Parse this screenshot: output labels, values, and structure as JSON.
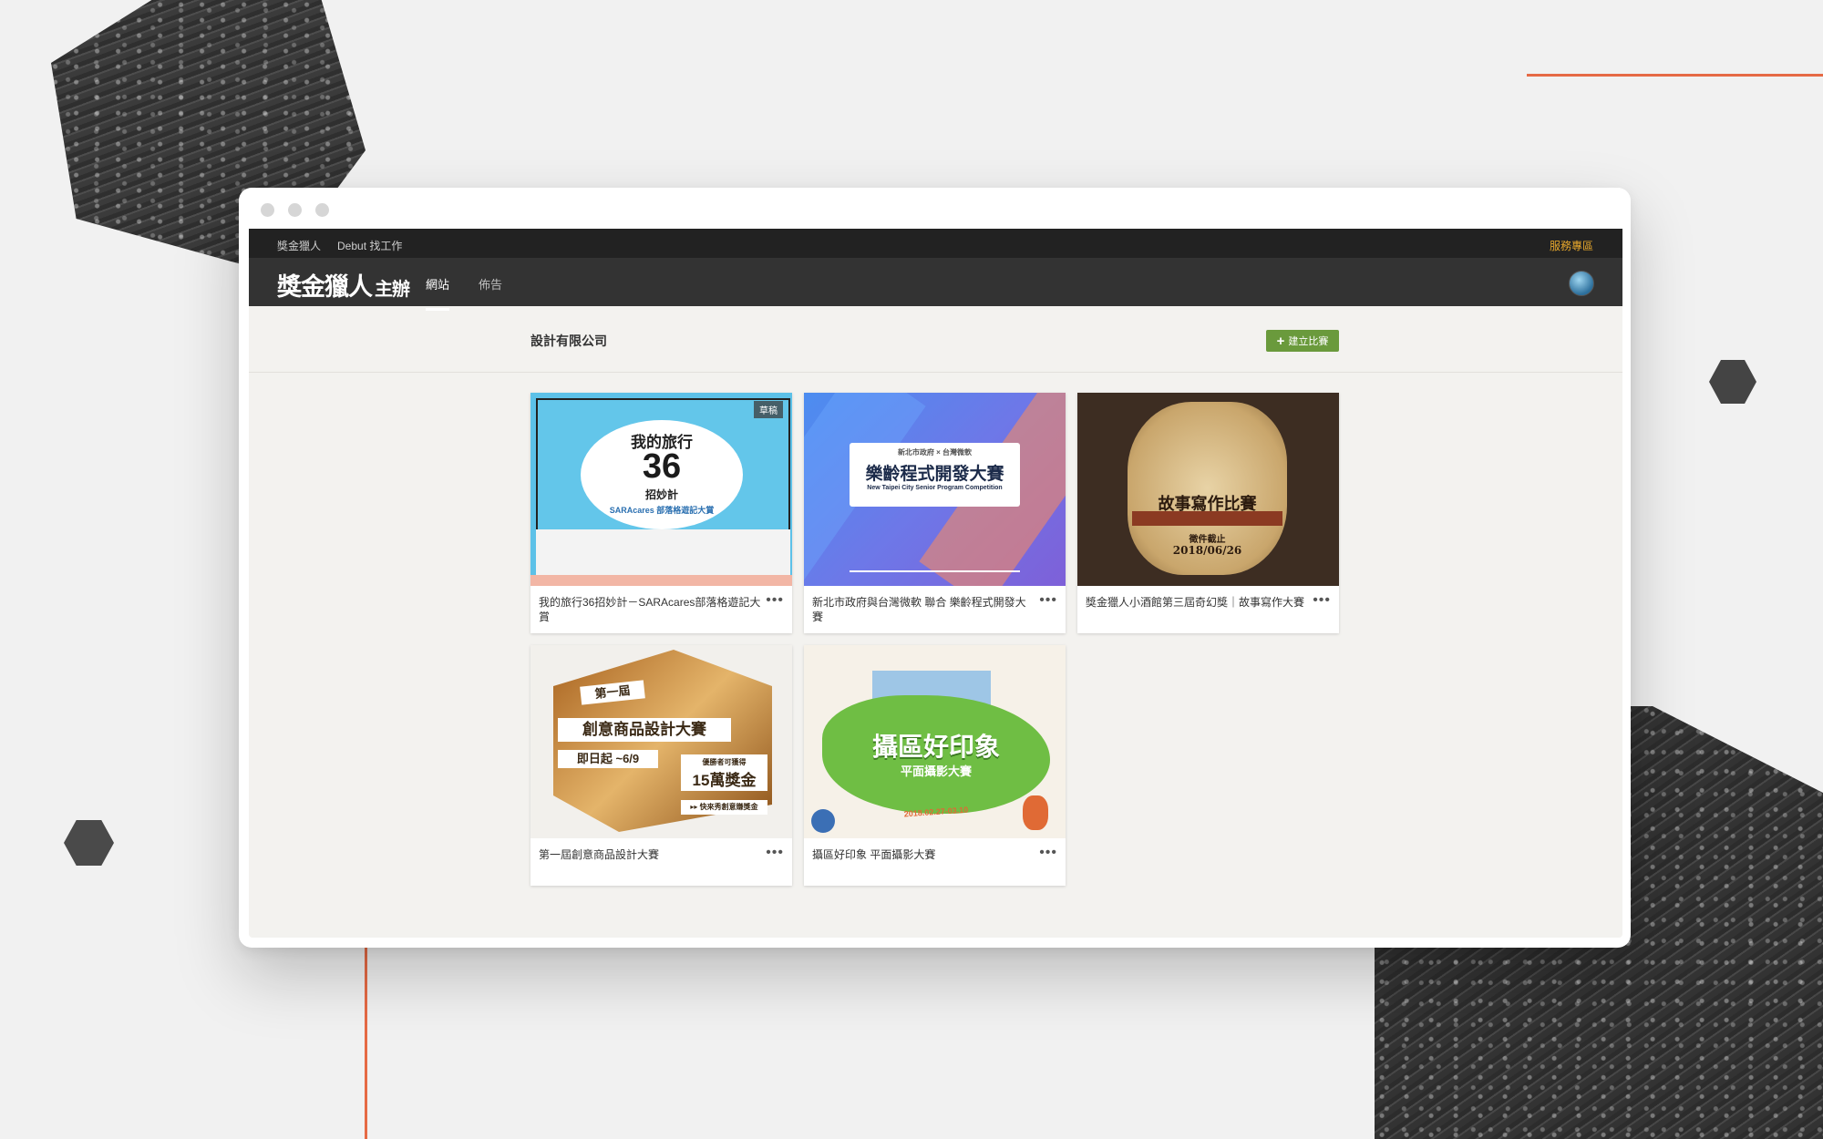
{
  "topbar": {
    "links": [
      "獎金獵人",
      "Debut 找工作"
    ],
    "service": "服務專區"
  },
  "navbar": {
    "logo": "獎金獵人",
    "logo_mark": "主辦",
    "tabs": [
      {
        "label": "網站",
        "active": true
      },
      {
        "label": "佈告",
        "active": false
      }
    ]
  },
  "page": {
    "company": "設計有限公司",
    "create_label": "建立比賽"
  },
  "cards": [
    {
      "title": "我的旅行36招妙計－SARAcares部落格遊記大賞",
      "badge": "草稿",
      "poster": {
        "line1": "我的旅行",
        "big": "36",
        "line2": "招妙計",
        "line3": "SARAcares 部落格遊記大賞"
      }
    },
    {
      "title": "新北市政府與台灣微軟 聯合 樂齡程式開發大賽",
      "poster": {
        "small": "新北市政府 × 台灣微軟",
        "main": "樂齡程式開發大賽",
        "sub": "New Taipei City Senior Program Competition"
      }
    },
    {
      "title": "獎金獵人小酒館第三屆奇幻獎｜故事寫作大賽",
      "poster": {
        "main": "故事寫作比賽",
        "deadline_label": "徵件截止",
        "deadline": "2018/06/26"
      }
    },
    {
      "title": "第一屆創意商品設計大賽",
      "poster": {
        "l1": "第一屆",
        "l2": "創意商品設計大賽",
        "l3": "即日起 ~6/9",
        "l4a": "優勝者可獲得",
        "l4b": "15萬獎金",
        "l5": "▸▸ 快來秀創意賺獎金"
      }
    },
    {
      "title": "攝區好印象 平面攝影大賽",
      "poster": {
        "main": "攝區好印象",
        "sub": "平面攝影大賽",
        "date": "2018.02.27-03.10"
      }
    }
  ],
  "colors": {
    "accent_line": "#e66a45",
    "create_button": "#6a9a3c",
    "service_link": "#e8a82c"
  }
}
